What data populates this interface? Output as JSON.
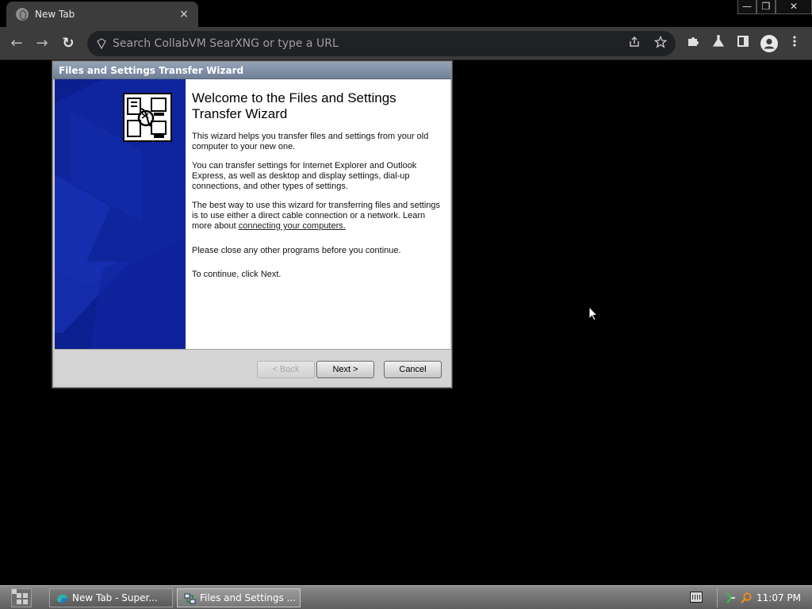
{
  "browser": {
    "tab": {
      "title": "New Tab",
      "close_glyph": "×",
      "icon": "globe-icon"
    },
    "window_controls": {
      "minimize": "—",
      "maximize": "❐",
      "close": "✕"
    },
    "nav": {
      "back": "←",
      "forward": "→",
      "reload": "↻"
    },
    "omnibox": {
      "placeholder": "Search CollabVM SearXNG or type a URL",
      "value": ""
    },
    "icons": [
      "share-icon",
      "star-icon",
      "extensions-icon",
      "labs-icon",
      "side-panel-icon",
      "profile-icon",
      "menu-icon"
    ]
  },
  "wizard": {
    "title": "Files and Settings Transfer Wizard",
    "heading": "Welcome to the Files and Settings Transfer Wizard",
    "para1": "This wizard helps you transfer files and settings from your old computer to your new one.",
    "para2": "You can transfer settings for Internet Explorer and Outlook Express, as well as desktop and display settings, dial-up connections, and other types of settings.",
    "para3_prefix": "The best way to use this wizard for transferring files and settings is to use either a direct cable connection or a network. Learn more about ",
    "para3_link": "connecting your computers.",
    "para4": "Please close any other programs before you continue.",
    "para5": "To continue, click Next.",
    "buttons": {
      "back": "< Back",
      "next": "Next >",
      "cancel": "Cancel"
    },
    "colors": {
      "banner": "#0b1f90"
    }
  },
  "taskbar": {
    "items": [
      {
        "label": "New Tab - Super...",
        "active": false
      },
      {
        "label": "Files and Settings ...",
        "active": true
      }
    ],
    "clock": "11:07 PM"
  }
}
